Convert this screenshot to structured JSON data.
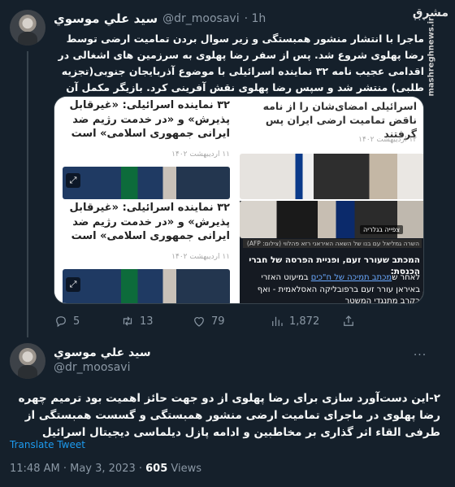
{
  "tweet1": {
    "name": "سيد علي موسوي",
    "handle": "@dr_moosavi",
    "time": "· 1h",
    "body": "ماجرا با انتشار منشور همبستگی و زیر سوال بردن تمامیت ارضی توسط رضا پهلوی شروع شد. پس از سفر رضا پهلوی به سرزمین های اشغالی در اقدامی عجیب نامه ۳۲ نماینده اسرائیلی با موضوع آذربایجان جنوبی(تجزیه طلبی) منتشر شد و سپس رضا پهلوی نقش آفرینی کرد. بازیگر مکمل آن وزیر اطلاعات اسرائیل بود",
    "media": {
      "top_right": {
        "headline": "اسرائیلی امضای‌شان را از نامه ناقض تمامیت ارضی ایران پس گرفتند",
        "date": "۱۲ اردیبهشت ۱۴۰۲"
      },
      "top_left": {
        "headline": "۳۲ نماینده اسرائیلی: «غیرقابل پذیرش» و «در خدمت رژیم ضد ایرانی جمهوری اسلامی» است",
        "date": "۱۱ اردیبهشت ۱۴۰۲"
      },
      "bottom_left": {
        "headline": "۳۲ نماینده اسرائیلی: «غیرقابل پذیرش» و «در خدمت رژیم ضد ایرانی جمهوری اسلامی» است",
        "date": "۱۱ اردیبهشت ۱۴۰۲"
      },
      "bottom_right": {
        "badge": "צפייה בגלריה",
        "caption": "השרה גמליאל עם בנו של השאה האיראני רזא פהלווי (צילום: AFP)",
        "headline": "המכתב שעורר זעם, ופניית הפרסה של חברי הכנסת:",
        "text": "לאחר ש",
        "link": "מכתב תמיכה של ח\"כים",
        "text2": " במיעוט האזרי באיראן עורר זעם ברפובליקה האסלאמית - ואף בקרב מתנגדי המשטר"
      }
    },
    "actions": {
      "replies": "5",
      "retweets": "13",
      "likes": "79",
      "views": "1,872"
    }
  },
  "tweet2": {
    "name": "سيد علي موسوي",
    "handle": "@dr_moosavi",
    "body": "۲-این دست‌آورد سازی برای رضا پهلوی از دو جهت حائز اهمیت بود ترمیم چهره رضا پهلوی در ماجرای تمامیت ارضی منشور همبستگی و گسست همبستگی از طرفی القاء اثر گذاری بر مخاطبین و ادامه پازل دیلماسی دیجیتال اسرائیل",
    "translate": "Translate Tweet",
    "time": "11:48 AM · May 3, 2023",
    "views_count": "605",
    "views_label": "Views"
  },
  "watermark": {
    "logo": "مشرق",
    "site": "mashreghnews.ir"
  },
  "colors": {
    "bg": "#15202b",
    "text": "#f7f9f9",
    "muted": "#8b98a5",
    "link": "#1d9bf0",
    "border": "#38444d"
  }
}
